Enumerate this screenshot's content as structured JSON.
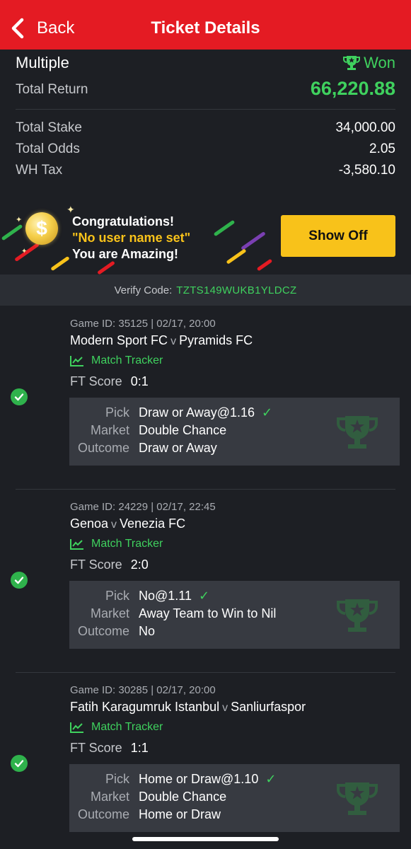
{
  "header": {
    "back_label": "Back",
    "title": "Ticket Details"
  },
  "summary": {
    "bet_type": "Multiple",
    "status": "Won",
    "total_return_label": "Total Return",
    "total_return": "66,220.88",
    "rows": [
      {
        "label": "Total Stake",
        "value": "34,000.00"
      },
      {
        "label": "Total Odds",
        "value": "2.05"
      },
      {
        "label": "WH Tax",
        "value": "-3,580.10"
      }
    ]
  },
  "banner": {
    "line1": "Congratulations!",
    "line2": "\"No user name set\"",
    "line3": "You are Amazing!",
    "button": "Show Off"
  },
  "verify": {
    "label": "Verify Code:",
    "code": "TZTS149WUKB1YLDCZ"
  },
  "selections": [
    {
      "game_id": "Game ID: 35125 | 02/17, 20:00",
      "home": "Modern Sport FC",
      "vs": "v",
      "away": "Pyramids FC",
      "tracker": "Match Tracker",
      "ft_label": "FT Score",
      "ft_score": "0:1",
      "pick_label": "Pick",
      "pick": "Draw or Away@1.16",
      "market_label": "Market",
      "market": "Double Chance",
      "outcome_label": "Outcome",
      "outcome": "Draw or Away"
    },
    {
      "game_id": "Game ID: 24229 | 02/17, 22:45",
      "home": "Genoa",
      "vs": "v",
      "away": "Venezia FC",
      "tracker": "Match Tracker",
      "ft_label": "FT Score",
      "ft_score": "2:0",
      "pick_label": "Pick",
      "pick": "No@1.11",
      "market_label": "Market",
      "market": "Away Team to Win to Nil",
      "outcome_label": "Outcome",
      "outcome": "No"
    },
    {
      "game_id": "Game ID: 30285 | 02/17, 20:00",
      "home": "Fatih Karagumruk Istanbul",
      "vs": "v",
      "away": "Sanliurfaspor",
      "tracker": "Match Tracker",
      "ft_label": "FT Score",
      "ft_score": "1:1",
      "pick_label": "Pick",
      "pick": "Home or Draw@1.10",
      "market_label": "Market",
      "market": "Double Chance",
      "outcome_label": "Outcome",
      "outcome": "Home or Draw"
    }
  ],
  "colors": {
    "header": "#e41b23",
    "win_green": "#3fd15e",
    "accent_yellow": "#f8c21a",
    "background": "#1d1f24"
  }
}
